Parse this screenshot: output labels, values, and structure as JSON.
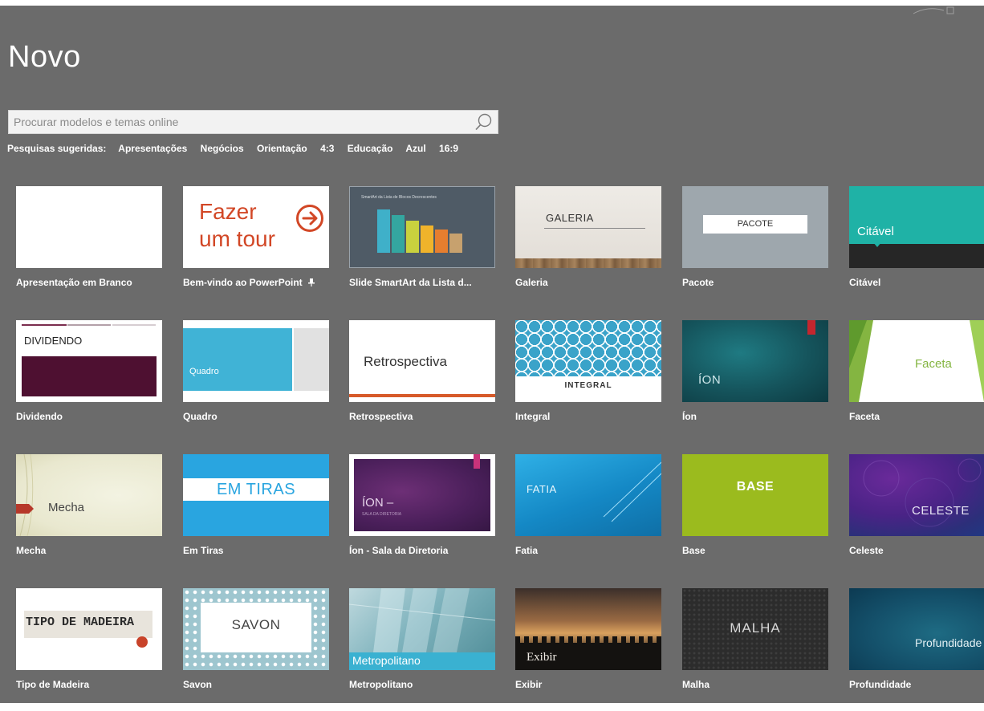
{
  "page": {
    "title": "Novo"
  },
  "search": {
    "placeholder": "Procurar modelos e temas online",
    "value": ""
  },
  "suggested": {
    "label": "Pesquisas sugeridas:",
    "items": [
      "Apresentações",
      "Negócios",
      "Orientação",
      "4:3",
      "Educação",
      "Azul",
      "16:9"
    ]
  },
  "templates": [
    {
      "label": "Apresentação em Branco"
    },
    {
      "label": "Bem-vindo ao PowerPoint",
      "thumb_text": [
        "Fazer",
        "um tour"
      ],
      "pin_icon": "pin-icon"
    },
    {
      "label": "Slide SmartArt da Lista d...",
      "thumb_text": "SmartArt da Lista de Blocos Decrescentes"
    },
    {
      "label": "Galeria",
      "thumb_text": "GALERIA"
    },
    {
      "label": "Pacote",
      "thumb_text": "PACOTE"
    },
    {
      "label": "Citável",
      "thumb_text": "Citável"
    },
    {
      "label": "Dividendo",
      "thumb_text": "DIVIDENDO"
    },
    {
      "label": "Quadro",
      "thumb_text": "Quadro"
    },
    {
      "label": "Retrospectiva",
      "thumb_text": "Retrospectiva"
    },
    {
      "label": "Integral",
      "thumb_text": "INTEGRAL"
    },
    {
      "label": "Íon",
      "thumb_text": "ÍON"
    },
    {
      "label": "Faceta",
      "thumb_text": "Faceta"
    },
    {
      "label": "Mecha",
      "thumb_text": "Mecha"
    },
    {
      "label": "Em Tiras",
      "thumb_text": "EM TIRAS"
    },
    {
      "label": "Íon - Sala da Diretoria",
      "thumb_text": "ÍON –",
      "thumb_sub": "SALA DA DIRETORIA"
    },
    {
      "label": "Fatia",
      "thumb_text": "FATIA"
    },
    {
      "label": "Base",
      "thumb_text": "BASE"
    },
    {
      "label": "Celeste",
      "thumb_text": "CELESTE"
    },
    {
      "label": "Tipo de Madeira",
      "thumb_text": "TIPO DE MADEIRA"
    },
    {
      "label": "Savon",
      "thumb_text": "SAVON"
    },
    {
      "label": "Metropolitano",
      "thumb_text": "Metropolitano"
    },
    {
      "label": "Exibir",
      "thumb_text": "Exibir"
    },
    {
      "label": "Malha",
      "thumb_text": "MALHA"
    },
    {
      "label": "Profundidade",
      "thumb_text": "Profundidade"
    }
  ],
  "colors": {
    "background": "#6b6b6b",
    "tour_accent": "#d24726",
    "citavel_teal": "#1fb2a6",
    "dividendo_maroon": "#4e1031",
    "quadro_blue": "#40b3d6",
    "base_green": "#9bbb1e"
  }
}
